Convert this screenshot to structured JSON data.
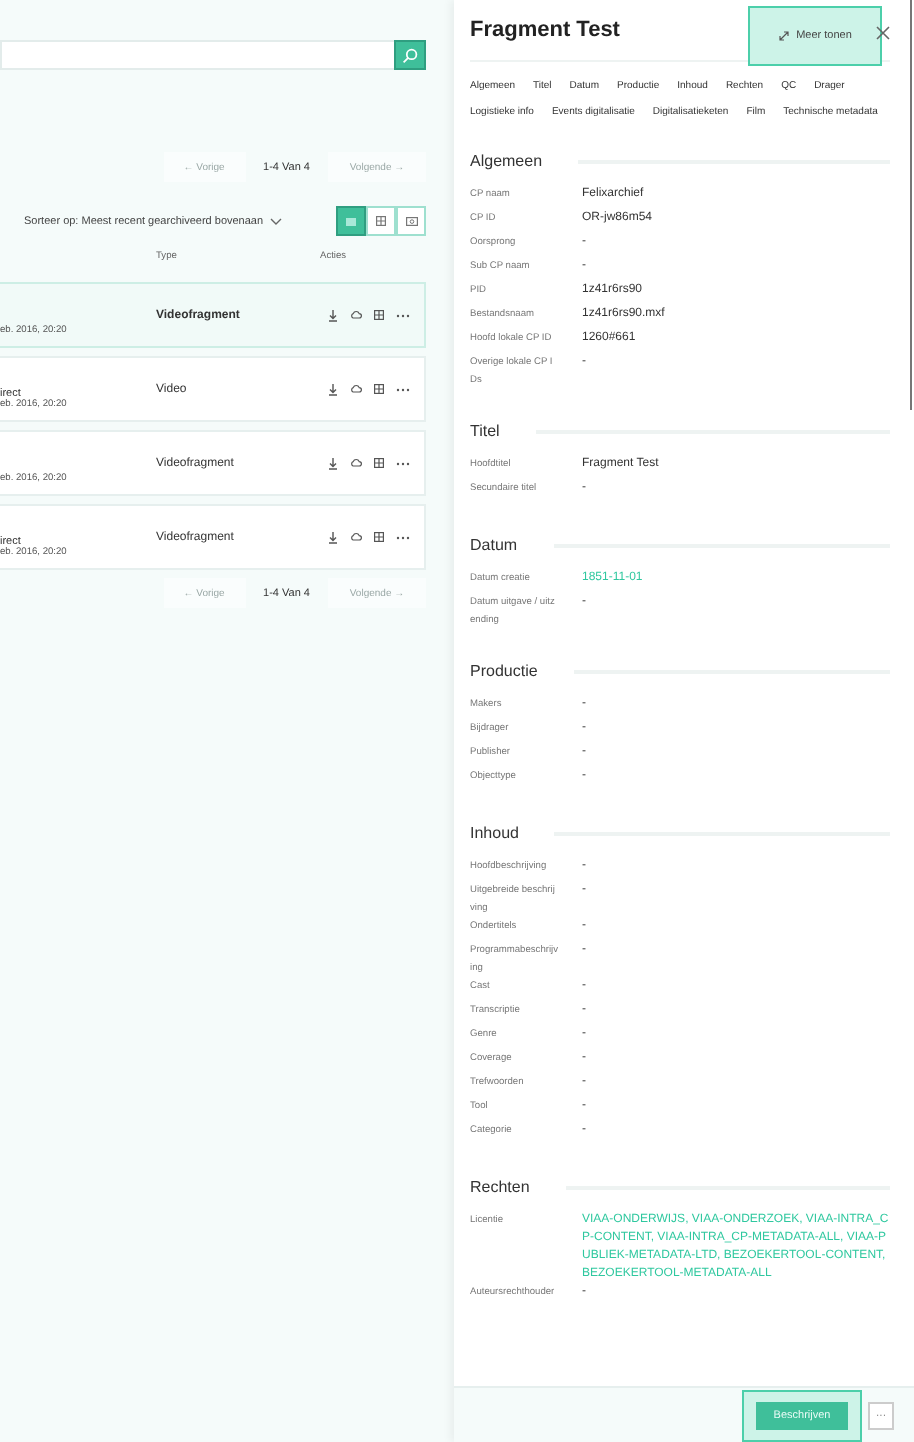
{
  "pagination_top": {
    "prev": "← Vorige",
    "range": "1-4 Van 4",
    "next": "Volgende →",
    "prev_disabled": true,
    "next_disabled": true
  },
  "sort": {
    "label": "Sorteer op: Meest recent gearchiveerd bovenaan"
  },
  "views": [
    {
      "kind": "list",
      "selected": true
    },
    {
      "kind": "grid",
      "selected": false
    },
    {
      "kind": "media",
      "selected": false
    }
  ],
  "columns": [
    "Type",
    "Acties"
  ],
  "rows": [
    {
      "date": "eb. 2016, 20:20",
      "type": "Videofragment",
      "selected": true
    },
    {
      "title": "irect",
      "date": "eb. 2016, 20:20",
      "type": "Video",
      "selected": false
    },
    {
      "date": "eb. 2016, 20:20",
      "type": "Videofragment",
      "selected": false
    },
    {
      "title": "irect",
      "date": "eb. 2016, 20:20",
      "type": "Videofragment",
      "selected": false
    }
  ],
  "pagination_bottom": {
    "prev": "← Vorige",
    "range": "1-4 Van 4",
    "next": "Volgende →",
    "prev_disabled": true,
    "next_disabled": true
  },
  "detail": {
    "title": "Fragment Test",
    "more_button": "Meer tonen",
    "tabs": [
      "Algemeen",
      "Titel",
      "Datum",
      "Productie",
      "Inhoud",
      "Rechten",
      "QC",
      "Drager",
      "Logistieke info",
      "Events digitalisatie",
      "Digitalisatieketen",
      "Film",
      "Technische metadata"
    ],
    "sections": [
      {
        "heading": "Algemeen",
        "fields": [
          {
            "label": "CP naam",
            "value": "Felixarchief",
            "kind": "text"
          },
          {
            "label": "CP ID",
            "value": "OR-jw86m54",
            "kind": "text"
          },
          {
            "label": "Oorsprong",
            "value": "-",
            "kind": "text"
          },
          {
            "label": "Sub CP naam",
            "value": "-",
            "kind": "text"
          },
          {
            "label": "PID",
            "value": "1z41r6rs90",
            "kind": "text"
          },
          {
            "label": "Bestandsnaam",
            "value": "1z41r6rs90.mxf",
            "kind": "text"
          },
          {
            "label": "Hoofd lokale CP ID",
            "value": "1260#661",
            "kind": "text"
          },
          {
            "label": "Overige lokale CP IDs",
            "value": "-",
            "kind": "text"
          }
        ]
      },
      {
        "heading": "Titel",
        "fields": [
          {
            "label": "Hoofdtitel",
            "value": "Fragment Test",
            "kind": "text"
          },
          {
            "label": "Secundaire titel",
            "value": "-",
            "kind": "text"
          }
        ]
      },
      {
        "heading": "Datum",
        "fields": [
          {
            "label": "Datum creatie",
            "value": "1851-11-01",
            "kind": "link"
          },
          {
            "label": "Datum uitgave / uitzending",
            "value": "-",
            "kind": "text"
          }
        ]
      },
      {
        "heading": "Productie",
        "fields": [
          {
            "label": "Makers",
            "value": "-",
            "kind": "text"
          },
          {
            "label": "Bijdrager",
            "value": "-",
            "kind": "text"
          },
          {
            "label": "Publisher",
            "value": "-",
            "kind": "text"
          },
          {
            "label": "Objecttype",
            "value": "-",
            "kind": "text"
          }
        ]
      },
      {
        "heading": "Inhoud",
        "fields": [
          {
            "label": "Hoofdbeschrijving",
            "value": "-",
            "kind": "text"
          },
          {
            "label": "Uitgebreide beschrijving",
            "value": "-",
            "kind": "text"
          },
          {
            "label": "Ondertitels",
            "value": "-",
            "kind": "text"
          },
          {
            "label": "Programmabeschrijving",
            "value": "-",
            "kind": "text"
          },
          {
            "label": "Cast",
            "value": "-",
            "kind": "text"
          },
          {
            "label": "Transcriptie",
            "value": "-",
            "kind": "text"
          },
          {
            "label": "Genre",
            "value": "-",
            "kind": "text"
          },
          {
            "label": "Coverage",
            "value": "-",
            "kind": "text"
          },
          {
            "label": "Trefwoorden",
            "value": "-",
            "kind": "text"
          },
          {
            "label": "Tool",
            "value": "-",
            "kind": "text"
          },
          {
            "label": "Categorie",
            "value": "-",
            "kind": "text"
          }
        ]
      },
      {
        "heading": "Rechten",
        "fields": [
          {
            "label": "Licentie",
            "value": "VIAA-ONDERWIJS, VIAA-ONDERZOEK, VIAA-INTRA_CP-CONTENT, VIAA-INTRA_CP-METADATA-ALL, VIAA-PUBLIEK-METADATA-LTD, BEZOEKERTOOL-CONTENT, BEZOEKERTOOL-METADATA-ALL",
            "kind": "link"
          },
          {
            "label": "Auteursrechthouder",
            "value": "-",
            "kind": "text"
          }
        ]
      }
    ],
    "footer": {
      "primary": "Beschrijven",
      "more": "···"
    }
  }
}
